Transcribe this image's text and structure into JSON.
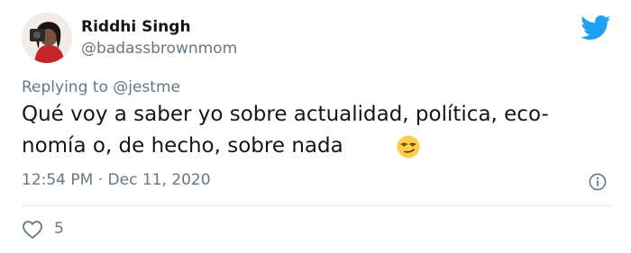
{
  "author": {
    "name": "Riddhi Singh",
    "handle": "@badassbrownmom"
  },
  "reply": {
    "prefix": "Replying to ",
    "mention": "@jestme"
  },
  "tweet": {
    "line1": "Qué voy a saber yo sobre actualidad, política, eco-",
    "line2": "nomía o, de hecho, sobre nada",
    "emoji": "smirking-face-emoji"
  },
  "meta": {
    "timestamp": "12:54 PM · Dec 11, 2020",
    "info_icon": "info-icon"
  },
  "actions": {
    "like_icon": "heart-icon",
    "like_count": "5"
  },
  "colors": {
    "twitter_blue": "#1da1f2",
    "text_primary": "#14171a",
    "text_secondary": "#657786",
    "divider": "#e1e8ed"
  }
}
